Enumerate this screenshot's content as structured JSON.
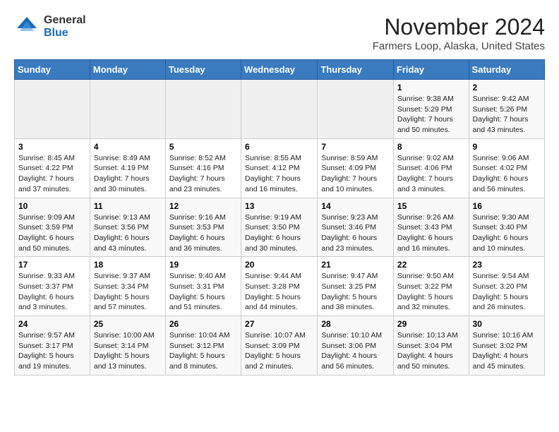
{
  "header": {
    "logo": {
      "general": "General",
      "blue": "Blue"
    },
    "title": "November 2024",
    "subtitle": "Farmers Loop, Alaska, United States"
  },
  "weekdays": [
    "Sunday",
    "Monday",
    "Tuesday",
    "Wednesday",
    "Thursday",
    "Friday",
    "Saturday"
  ],
  "weeks": [
    [
      {
        "day": "",
        "info": ""
      },
      {
        "day": "",
        "info": ""
      },
      {
        "day": "",
        "info": ""
      },
      {
        "day": "",
        "info": ""
      },
      {
        "day": "",
        "info": ""
      },
      {
        "day": "1",
        "info": "Sunrise: 9:38 AM\nSunset: 5:29 PM\nDaylight: 7 hours\nand 50 minutes."
      },
      {
        "day": "2",
        "info": "Sunrise: 9:42 AM\nSunset: 5:26 PM\nDaylight: 7 hours\nand 43 minutes."
      }
    ],
    [
      {
        "day": "3",
        "info": "Sunrise: 8:45 AM\nSunset: 4:22 PM\nDaylight: 7 hours\nand 37 minutes."
      },
      {
        "day": "4",
        "info": "Sunrise: 8:49 AM\nSunset: 4:19 PM\nDaylight: 7 hours\nand 30 minutes."
      },
      {
        "day": "5",
        "info": "Sunrise: 8:52 AM\nSunset: 4:16 PM\nDaylight: 7 hours\nand 23 minutes."
      },
      {
        "day": "6",
        "info": "Sunrise: 8:55 AM\nSunset: 4:12 PM\nDaylight: 7 hours\nand 16 minutes."
      },
      {
        "day": "7",
        "info": "Sunrise: 8:59 AM\nSunset: 4:09 PM\nDaylight: 7 hours\nand 10 minutes."
      },
      {
        "day": "8",
        "info": "Sunrise: 9:02 AM\nSunset: 4:06 PM\nDaylight: 7 hours\nand 3 minutes."
      },
      {
        "day": "9",
        "info": "Sunrise: 9:06 AM\nSunset: 4:02 PM\nDaylight: 6 hours\nand 56 minutes."
      }
    ],
    [
      {
        "day": "10",
        "info": "Sunrise: 9:09 AM\nSunset: 3:59 PM\nDaylight: 6 hours\nand 50 minutes."
      },
      {
        "day": "11",
        "info": "Sunrise: 9:13 AM\nSunset: 3:56 PM\nDaylight: 6 hours\nand 43 minutes."
      },
      {
        "day": "12",
        "info": "Sunrise: 9:16 AM\nSunset: 3:53 PM\nDaylight: 6 hours\nand 36 minutes."
      },
      {
        "day": "13",
        "info": "Sunrise: 9:19 AM\nSunset: 3:50 PM\nDaylight: 6 hours\nand 30 minutes."
      },
      {
        "day": "14",
        "info": "Sunrise: 9:23 AM\nSunset: 3:46 PM\nDaylight: 6 hours\nand 23 minutes."
      },
      {
        "day": "15",
        "info": "Sunrise: 9:26 AM\nSunset: 3:43 PM\nDaylight: 6 hours\nand 16 minutes."
      },
      {
        "day": "16",
        "info": "Sunrise: 9:30 AM\nSunset: 3:40 PM\nDaylight: 6 hours\nand 10 minutes."
      }
    ],
    [
      {
        "day": "17",
        "info": "Sunrise: 9:33 AM\nSunset: 3:37 PM\nDaylight: 6 hours\nand 3 minutes."
      },
      {
        "day": "18",
        "info": "Sunrise: 9:37 AM\nSunset: 3:34 PM\nDaylight: 5 hours\nand 57 minutes."
      },
      {
        "day": "19",
        "info": "Sunrise: 9:40 AM\nSunset: 3:31 PM\nDaylight: 5 hours\nand 51 minutes."
      },
      {
        "day": "20",
        "info": "Sunrise: 9:44 AM\nSunset: 3:28 PM\nDaylight: 5 hours\nand 44 minutes."
      },
      {
        "day": "21",
        "info": "Sunrise: 9:47 AM\nSunset: 3:25 PM\nDaylight: 5 hours\nand 38 minutes."
      },
      {
        "day": "22",
        "info": "Sunrise: 9:50 AM\nSunset: 3:22 PM\nDaylight: 5 hours\nand 32 minutes."
      },
      {
        "day": "23",
        "info": "Sunrise: 9:54 AM\nSunset: 3:20 PM\nDaylight: 5 hours\nand 26 minutes."
      }
    ],
    [
      {
        "day": "24",
        "info": "Sunrise: 9:57 AM\nSunset: 3:17 PM\nDaylight: 5 hours\nand 19 minutes."
      },
      {
        "day": "25",
        "info": "Sunrise: 10:00 AM\nSunset: 3:14 PM\nDaylight: 5 hours\nand 13 minutes."
      },
      {
        "day": "26",
        "info": "Sunrise: 10:04 AM\nSunset: 3:12 PM\nDaylight: 5 hours\nand 8 minutes."
      },
      {
        "day": "27",
        "info": "Sunrise: 10:07 AM\nSunset: 3:09 PM\nDaylight: 5 hours\nand 2 minutes."
      },
      {
        "day": "28",
        "info": "Sunrise: 10:10 AM\nSunset: 3:06 PM\nDaylight: 4 hours\nand 56 minutes."
      },
      {
        "day": "29",
        "info": "Sunrise: 10:13 AM\nSunset: 3:04 PM\nDaylight: 4 hours\nand 50 minutes."
      },
      {
        "day": "30",
        "info": "Sunrise: 10:16 AM\nSunset: 3:02 PM\nDaylight: 4 hours\nand 45 minutes."
      }
    ]
  ]
}
